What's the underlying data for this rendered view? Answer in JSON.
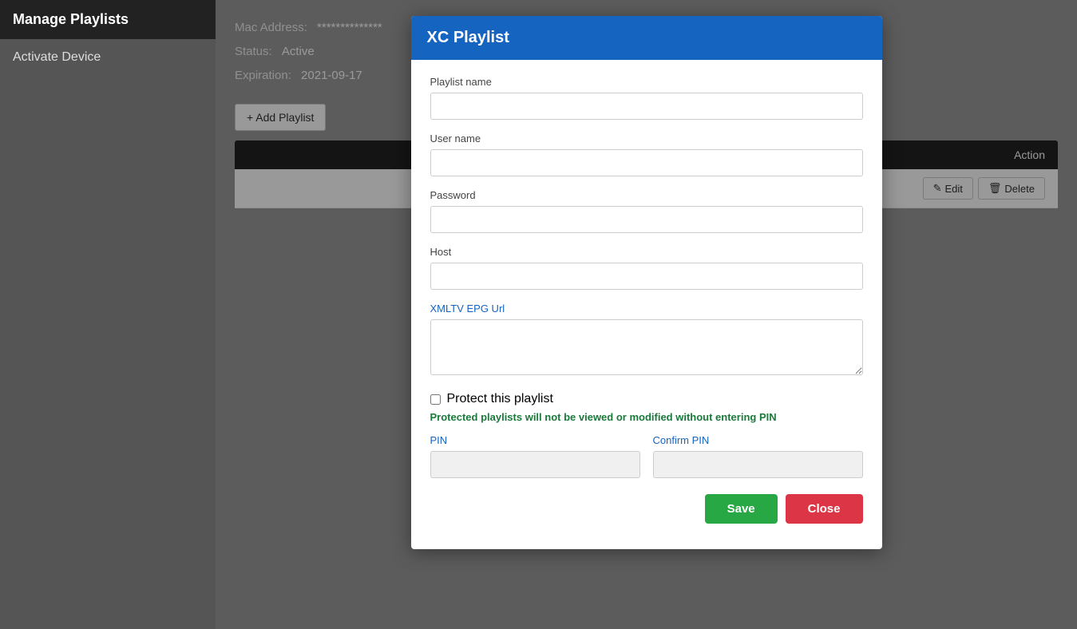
{
  "sidebar": {
    "items": [
      {
        "label": "Manage Playlists",
        "active": true
      },
      {
        "label": "Activate Device",
        "active": false
      }
    ]
  },
  "device": {
    "mac_address_label": "Mac Address:",
    "mac_address_value": "**************",
    "status_label": "Status:",
    "status_value": "Active",
    "expiration_label": "Expiration:",
    "expiration_value": "2021-09-17"
  },
  "add_button_label": "+ Add Playlist",
  "table": {
    "action_column": "Action",
    "edit_label": "Edit",
    "delete_label": "Delete"
  },
  "modal": {
    "title": "XC Playlist",
    "playlist_name_label": "Playlist name",
    "playlist_name_placeholder": "",
    "username_label": "User name",
    "username_placeholder": "",
    "password_label": "Password",
    "password_placeholder": "",
    "host_label": "Host",
    "host_placeholder": "",
    "epg_label": "XMLTV EPG Url",
    "epg_placeholder": "",
    "protect_checkbox_label": "Protect this playlist",
    "protect_info": "Protected playlists will not be viewed or modified without entering PIN",
    "pin_label": "PIN",
    "confirm_pin_label": "Confirm PIN",
    "save_button": "Save",
    "close_button": "Close"
  }
}
